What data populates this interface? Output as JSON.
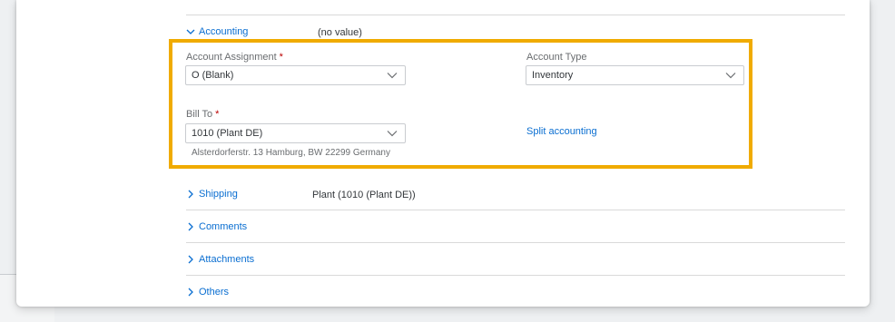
{
  "accounting": {
    "title": "Accounting",
    "summary": "(no value)",
    "account_assignment": {
      "label": "Account Assignment",
      "required_mark": "*",
      "value": "O (Blank)"
    },
    "account_type": {
      "label": "Account Type",
      "value": "Inventory"
    },
    "bill_to": {
      "label": "Bill To",
      "required_mark": "*",
      "value": "1010 (Plant DE)",
      "address": "Alsterdorferstr. 13 Hamburg, BW 22299 Germany"
    },
    "split_link": "Split accounting"
  },
  "sections": [
    {
      "title": "Shipping",
      "summary": "Plant (1010 (Plant DE))"
    },
    {
      "title": "Comments"
    },
    {
      "title": "Attachments"
    },
    {
      "title": "Others"
    }
  ],
  "colors": {
    "link": "#0a6ed1",
    "highlight": "#f0ab00",
    "required": "#bb0000"
  }
}
